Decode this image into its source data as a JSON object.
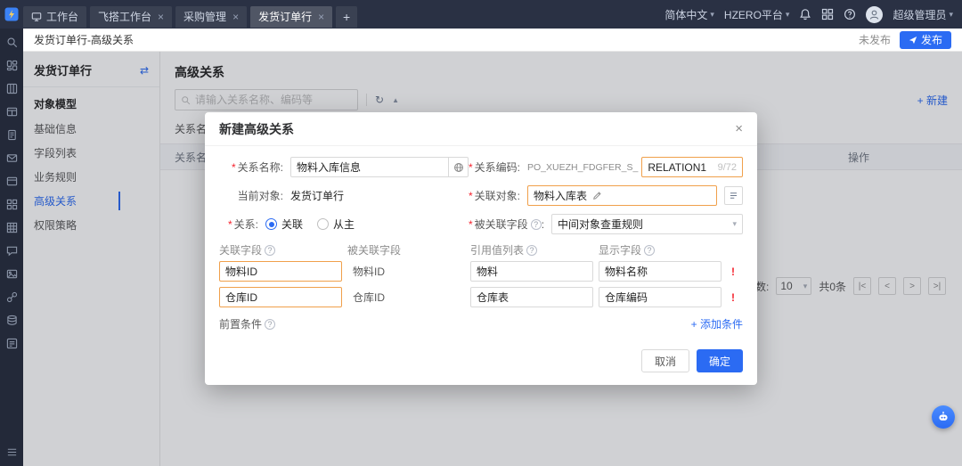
{
  "icons": {
    "required": "*",
    "close": "×",
    "help": "?",
    "error": "!",
    "caret": "▾",
    "swap": "⇄",
    "refresh": "↻",
    "collapse": "▲",
    "plus": "+",
    "colon": ":"
  },
  "topbar": {
    "tabs": [
      {
        "label": "工作台"
      },
      {
        "label": "飞搭工作台"
      },
      {
        "label": "采购管理"
      },
      {
        "label": "发货订单行"
      }
    ],
    "right": {
      "language": "简体中文",
      "tenant": "HZERO平台",
      "user": "超级管理员"
    }
  },
  "pagebar": {
    "breadcrumb": "发货订单行-高级关系",
    "status": "未发布",
    "publish": "发布"
  },
  "sidebar": {
    "title": "发货订单行",
    "section": "对象模型",
    "items": [
      {
        "label": "基础信息"
      },
      {
        "label": "字段列表"
      },
      {
        "label": "业务规则"
      },
      {
        "label": "高级关系"
      },
      {
        "label": "权限策略"
      }
    ]
  },
  "list_page": {
    "title": "高级关系",
    "new_button": "+ 新建",
    "search_placeholder": "请输入关系名称、编码等",
    "filter_label": "关系名称",
    "table": {
      "col_name": "关系名称",
      "col_action": "操作"
    },
    "pagination": {
      "page_size_label": "每页行数:",
      "page_size": "10",
      "total": "共0条",
      "first": "|<",
      "prev": "<",
      "next": ">",
      "last": ">|"
    }
  },
  "modal": {
    "title": "新建高级关系",
    "fields": {
      "name_label": "关系名称:",
      "name_value": "物料入库信息",
      "code_label": "关系编码:",
      "code_prefix": "PO_XUEZH_FDGFER_S_",
      "code_value": "RELATION1",
      "code_counter": "9/72",
      "current_label": "当前对象:",
      "current_value": "发货订单行",
      "related_label": "关联对象:",
      "related_value": "物料入库表",
      "relation_label": "关系:",
      "radio_assoc": "关联",
      "radio_master": "从主",
      "related_field_label": "被关联字段",
      "related_field_value": "中间对象查重规则"
    },
    "table": {
      "headers": [
        "关联字段",
        "被关联字段",
        "引用值列表",
        "显示字段"
      ],
      "rows": [
        {
          "field": "物料ID",
          "related": "物料ID",
          "list": "物料",
          "display": "物料名称"
        },
        {
          "field": "仓库ID",
          "related": "仓库ID",
          "list": "仓库表",
          "display": "仓库编码"
        }
      ]
    },
    "precondition_label": "前置条件",
    "add_condition": "+ 添加条件",
    "cancel": "取消",
    "ok": "确定"
  },
  "rail_icons": [
    "search",
    "dashboard",
    "kanban",
    "table",
    "document",
    "mail",
    "card",
    "apps",
    "grid",
    "chat",
    "image",
    "link",
    "database",
    "form",
    "menu"
  ]
}
